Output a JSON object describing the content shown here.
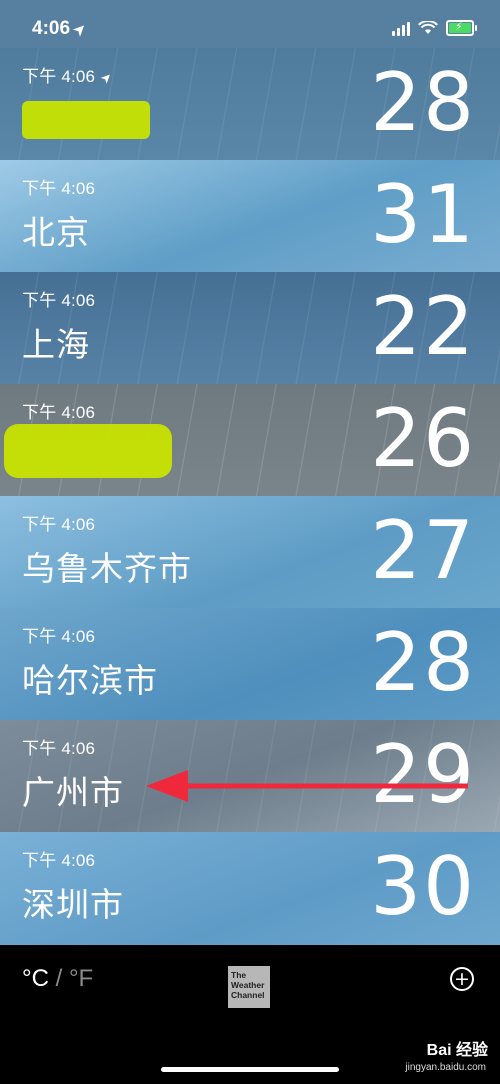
{
  "status_bar": {
    "time": "4:06",
    "bg": "#567fa0"
  },
  "rows": [
    {
      "time": "下午 4:06",
      "city": "",
      "temp": "28",
      "location_arrow": true,
      "bg": "linear-gradient(180deg,#4f7b9d,#5a86a8)",
      "redacted": true
    },
    {
      "time": "下午 4:06",
      "city": "北京",
      "temp": "31",
      "bg": "linear-gradient(160deg,#9fcbe6,#5f9ec7 55%,#79acd0)"
    },
    {
      "time": "下午 4:06",
      "city": "上海",
      "temp": "22",
      "bg": "linear-gradient(180deg,#466f94,#5782a6)"
    },
    {
      "time": "下午 4:06",
      "city": "",
      "temp": "26",
      "bg": "linear-gradient(180deg,#6f7a80,#7a858b)",
      "redacted": true
    },
    {
      "time": "下午 4:06",
      "city": "乌鲁木齐市",
      "temp": "27",
      "bg": "linear-gradient(160deg,#8dbfe0,#5e9cc5 60%,#6aa6cc)"
    },
    {
      "time": "下午 4:06",
      "city": "哈尔滨市",
      "temp": "28",
      "bg": "linear-gradient(160deg,#6ea6cc,#4f8fbd 60%,#5d9bc5)"
    },
    {
      "time": "下午 4:06",
      "city": "广州市",
      "temp": "29",
      "bg": "linear-gradient(160deg,#7c8c9a,#6d7d8b 50%,#9aa8b3)"
    },
    {
      "time": "下午 4:06",
      "city": "深圳市",
      "temp": "30",
      "bg": "linear-gradient(160deg,#79b0d6,#5e9bc6 60%,#6ea8cf)"
    }
  ],
  "toolbar": {
    "celsius": "°C",
    "separator": "/",
    "fahrenheit": "°F",
    "logo_text": "The Weather Channel",
    "add_icon": "plus-circle-icon"
  },
  "watermark": {
    "brand": "Bai 经验",
    "url": "jingyan.baidu.com"
  },
  "annotation": {
    "arrow_color": "#f0283c"
  }
}
